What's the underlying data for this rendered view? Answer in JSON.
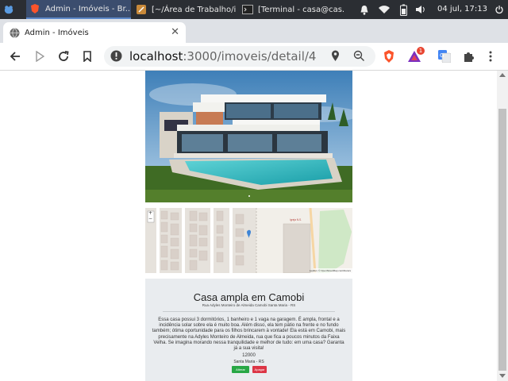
{
  "taskbar": {
    "items": [
      {
        "label": "Admin - Imóveis - Br..."
      },
      {
        "label": "[~/Área de Trabalho/i..."
      },
      {
        "label": "[Terminal - casa@cas..."
      }
    ],
    "clock": "04 jul, 17:13"
  },
  "browser": {
    "tab_title": "Admin - Imóveis",
    "url_host": "localhost",
    "url_path": ":3000/imoveis/detail/4",
    "notification_badge": "1"
  },
  "map": {
    "zoom_in": "+",
    "zoom_out": "−",
    "place_label_1": "Igreja\nN. S. do\nRosário",
    "attribution": "Leaflet | © OpenStreetMap contributors"
  },
  "property": {
    "title": "Casa ampla em Camobi",
    "address": "Rua Adyles Monteiro de Almeida Camobi Santa Maria - RS",
    "description": "Essa casa possui 3 dormitórios, 1 banheiro e 1 vaga na garagem. É ampla, frontal e a incidência solar sobre ela é muito boa. Além disso, ela tem pátio na frente e no fundo também; ótima oportunidade para os filhos brincarem à vontade! Ela está em Camobi, mais precisamente na Adyles Monteiro de Almeida, rua que fica a poucos minutos da Faixa Velha. Se imagina morando nessa tranquilidade e melhor de tudo: em uma casa? Garanta já a sua visita!",
    "price": "12000",
    "city": "Santa Maria - RS",
    "edit_label": "Alterar",
    "delete_label": "Apagar"
  },
  "colors": {
    "edit_button": "#28a745",
    "delete_button": "#dc3545",
    "card_bg": "#e9ecef"
  }
}
